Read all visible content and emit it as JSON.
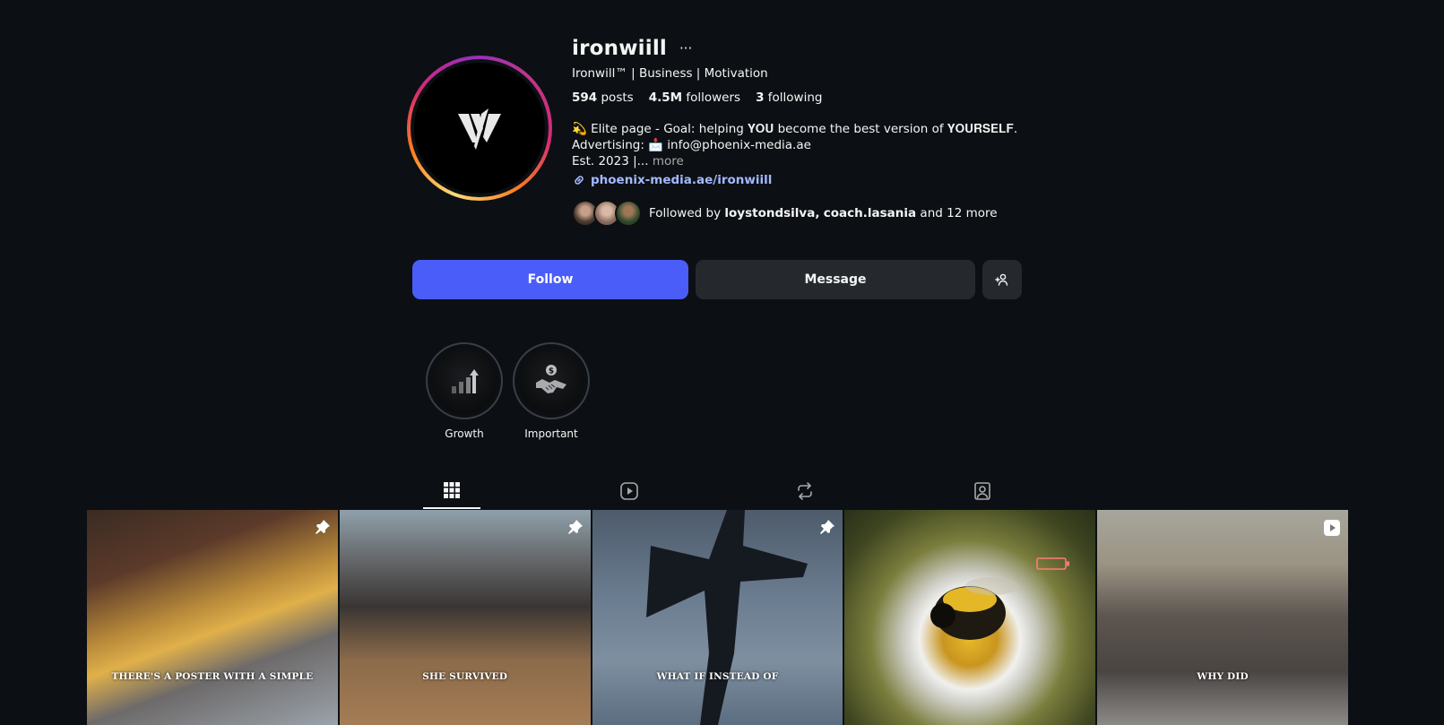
{
  "profile": {
    "username": "ironwiill",
    "more_label": "···",
    "full_name": "Ironwill™ | Business | Motivation",
    "stats": {
      "posts_value": "594",
      "posts_label": "posts",
      "followers_value": "4.5M",
      "followers_label": "followers",
      "following_value": "3",
      "following_label": "following"
    },
    "bio_line1": "💫 Elite page - Goal: helping 𝐘𝐎𝐔 become the best version of 𝐘𝐎𝐔𝐑𝐒𝐄𝐋𝐅.",
    "bio_line2": "Advertising: 📩 info@phoenix-media.ae",
    "bio_line3": "Est. 2023 |...",
    "bio_more": "more",
    "link": "phoenix-media.ae/ironwiill",
    "followed_by_prefix": "Followed by",
    "followed_by_user1": "loystondsilva",
    "followed_by_sep": ",",
    "followed_by_user2": "coach.lasania",
    "followed_by_suffix": "and 12 more"
  },
  "actions": {
    "follow_label": "Follow",
    "message_label": "Message",
    "add_user_icon": "person-add-icon"
  },
  "highlights": [
    {
      "label": "Growth",
      "icon": "growth-chart-icon"
    },
    {
      "label": "Important",
      "icon": "handshake-money-icon"
    }
  ],
  "tabs": [
    {
      "name": "posts",
      "icon": "grid-icon",
      "active": true
    },
    {
      "name": "reels",
      "icon": "reels-icon",
      "active": false
    },
    {
      "name": "reposts",
      "icon": "repost-icon",
      "active": false
    },
    {
      "name": "tagged",
      "icon": "tagged-icon",
      "active": false
    }
  ],
  "posts": [
    {
      "caption": "THERE'S A POSTER WITH A SIMPLE",
      "badge": "pin-icon"
    },
    {
      "caption": "SHE SURVIVED",
      "badge": "pin-icon"
    },
    {
      "caption": "WHAT IF INSTEAD OF",
      "badge": "pin-icon"
    },
    {
      "caption": "",
      "badge": ""
    },
    {
      "caption": "WHY DID",
      "badge": "reel-icon"
    }
  ],
  "colors": {
    "background": "#0c1014",
    "follow_button": "#4a5df9",
    "secondary_button": "#25292e",
    "link": "#a4b8ff"
  }
}
